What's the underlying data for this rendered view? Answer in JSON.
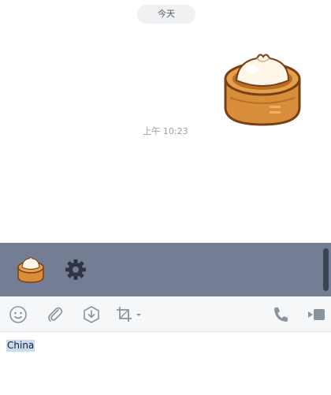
{
  "chat": {
    "date_label": "今天",
    "messages": [
      {
        "type": "sticker",
        "sticker": "steamed-bun-in-bamboo-basket",
        "time": "上午 10:23"
      }
    ]
  },
  "sticker_panel": {
    "tabs": [
      {
        "icon": "steamed-bun-sticker-icon",
        "selected": true
      }
    ],
    "settings_icon": "gear-icon",
    "background": "#737d93"
  },
  "toolbar": {
    "buttons": [
      {
        "name": "emoji",
        "icon": "smiley-icon"
      },
      {
        "name": "attach",
        "icon": "paperclip-icon"
      },
      {
        "name": "save",
        "icon": "download-hexagon-icon"
      },
      {
        "name": "screenshot",
        "icon": "crop-icon",
        "has_dropdown": true
      },
      {
        "name": "voice-call",
        "icon": "phone-icon"
      },
      {
        "name": "video-call",
        "icon": "video-camera-icon"
      }
    ]
  },
  "input": {
    "value": "China"
  }
}
